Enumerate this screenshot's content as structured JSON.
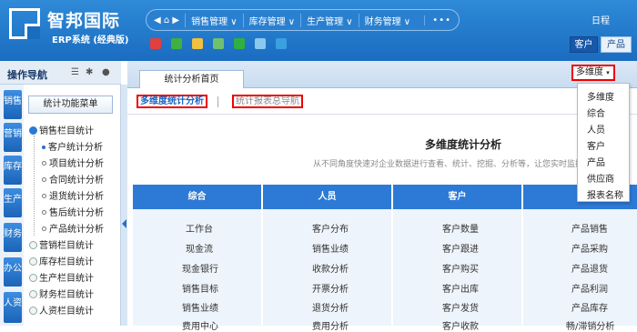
{
  "header": {
    "brand": "智邦国际",
    "brand_sub": "ERP系统 (经典版)",
    "nav_arrows": "◀ ⌂ ▶",
    "menu": [
      "销售管理 ∨",
      "库存管理 ∨",
      "生产管理 ∨",
      "财务管理 ∨"
    ],
    "more": "•••",
    "log": "日程",
    "tab_customer": "客户",
    "tab_product": "产品",
    "quick_icons": [
      "flag-icon",
      "phone-icon",
      "document-icon",
      "mail-icon",
      "wechat-icon",
      "apps-icon",
      "notes-icon"
    ],
    "quick_colors": [
      "#e04040",
      "#40b040",
      "#f0c040",
      "#70c070",
      "#30b040",
      "#8ac8f0",
      "#3aa0e0"
    ]
  },
  "sidebar": {
    "title": "操作导航",
    "vertical_tabs": [
      "销售",
      "营销",
      "库存",
      "生产",
      "财务",
      "办公",
      "人资"
    ],
    "func_button": "统计功能菜单",
    "tree": [
      {
        "label": "销售栏目统计",
        "kind": "open"
      },
      {
        "label": "客户统计分析",
        "kind": "leaf-active"
      },
      {
        "label": "项目统计分析",
        "kind": "leaf"
      },
      {
        "label": "合同统计分析",
        "kind": "leaf"
      },
      {
        "label": "退货统计分析",
        "kind": "leaf"
      },
      {
        "label": "售后统计分析",
        "kind": "leaf"
      },
      {
        "label": "产品统计分析",
        "kind": "leaf"
      },
      {
        "label": "营销栏目统计",
        "kind": "closed"
      },
      {
        "label": "库存栏目统计",
        "kind": "closed"
      },
      {
        "label": "生产栏目统计",
        "kind": "closed"
      },
      {
        "label": "财务栏目统计",
        "kind": "closed"
      },
      {
        "label": "人资栏目统计",
        "kind": "closed"
      }
    ]
  },
  "content": {
    "page_tab": "统计分析首页",
    "dimension_select": "多维度",
    "subnav_active": "多维度统计分析",
    "subnav_other": "统计报表总导航",
    "title": "多维度统计分析",
    "subtitle": "从不同角度快速对企业数据进行查看、统计、挖掘、分析等，让您实时监控",
    "columns": [
      "综合",
      "人员",
      "客户",
      ""
    ],
    "rows": [
      [
        "工作台",
        "客户分布",
        "客户数量",
        "产品销售"
      ],
      [
        "现金流",
        "销售业绩",
        "客户跟进",
        "产品采购"
      ],
      [
        "现金银行",
        "收款分析",
        "客户购买",
        "产品退货"
      ],
      [
        "销售目标",
        "开票分析",
        "客户出库",
        "产品利润"
      ],
      [
        "销售业绩",
        "退货分析",
        "客户发货",
        "产品库存"
      ],
      [
        "费用中心",
        "费用分析",
        "客户收款",
        "畅/滞销分析"
      ]
    ]
  },
  "dropdown": {
    "options": [
      "多维度",
      "综合",
      "人员",
      "客户",
      "产品",
      "供应商",
      "报表名称"
    ]
  }
}
